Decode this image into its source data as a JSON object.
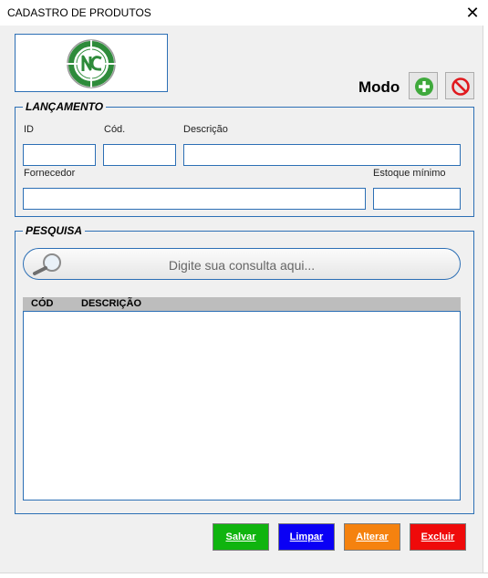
{
  "window": {
    "title": "CADASTRO DE PRODUTOS",
    "close_glyph": "✕"
  },
  "logo": {
    "icon": "north-cross-logo"
  },
  "mode": {
    "label": "Modo",
    "new_icon": "plus-circle-icon",
    "cancel_icon": "prohibited-icon"
  },
  "lancamento": {
    "legend": "LANÇAMENTO",
    "fields": {
      "id": {
        "label": "ID",
        "value": ""
      },
      "cod": {
        "label": "Cód.",
        "value": ""
      },
      "descricao": {
        "label": "Descrição",
        "value": ""
      },
      "fornecedor": {
        "label": "Fornecedor",
        "value": ""
      },
      "estoque_minimo": {
        "label": "Estoque mínimo",
        "value": ""
      }
    }
  },
  "pesquisa": {
    "legend": "PESQUISA",
    "search_placeholder": "Digite sua consulta aqui...",
    "columns": [
      "CÓD",
      "DESCRIÇÃO"
    ],
    "rows": []
  },
  "actions": {
    "save": {
      "label": "Salvar",
      "color": "#10b40f"
    },
    "clear": {
      "label": "Limpar",
      "color": "#0a00f5"
    },
    "edit": {
      "label": "Alterar",
      "color": "#f5820f"
    },
    "delete": {
      "label": "Excluir",
      "color": "#ef0a0a"
    }
  },
  "colors": {
    "accent": "#2c6fb5",
    "form_bg": "#f0f0f0"
  }
}
